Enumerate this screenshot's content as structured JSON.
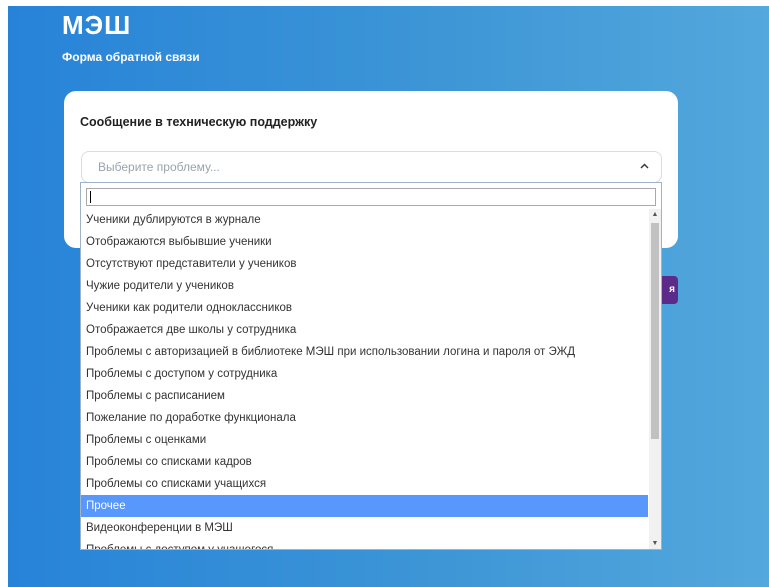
{
  "header": {
    "logo": "МЭШ",
    "subtitle": "Форма обратной связи"
  },
  "form": {
    "title": "Сообщение в техническую поддержку",
    "select_placeholder": "Выберите проблему...",
    "submit_label_fragment": "я"
  },
  "dropdown": {
    "search_value": "",
    "selected_index": 13,
    "options": [
      "Ученики дублируются в журнале",
      "Отображаются выбывшие ученики",
      "Отсутствуют представители у учеников",
      "Чужие родители у учеников",
      "Ученики как родители одноклассников",
      "Отображается две школы у сотрудника",
      "Проблемы с авторизацией в библиотеке МЭШ при использовании логина и пароля от ЭЖД",
      "Проблемы с доступом у сотрудника",
      "Проблемы с расписанием",
      "Пожелание по доработке функционала",
      "Проблемы с оценками",
      "Проблемы со списками кадров",
      "Проблемы со списками учащихся",
      "Прочее",
      "Видеоконференции в МЭШ",
      "Проблемы с доступом у учащегося"
    ]
  },
  "icons": {
    "select_toggle": "chevron-up-icon",
    "scroll_up": "arrow-up-icon",
    "scroll_down": "arrow-down-icon"
  },
  "colors": {
    "brand_blue": "#2783d8",
    "selected_option": "#5897fb",
    "submit_button": "#5c2b8a"
  }
}
